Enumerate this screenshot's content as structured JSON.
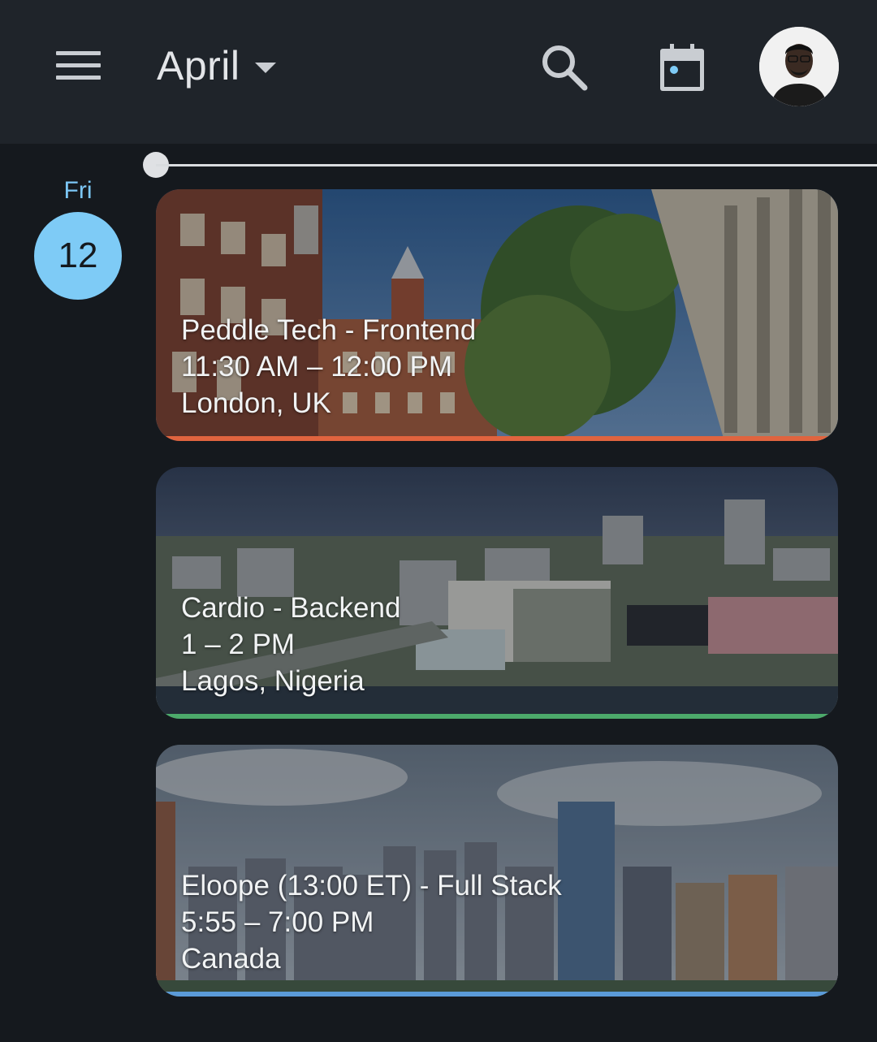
{
  "header": {
    "menu_icon": "hamburger-menu-icon",
    "month": "April",
    "search_icon": "search-icon",
    "today_icon": "calendar-today-icon",
    "avatar": "user-avatar"
  },
  "day": {
    "weekday": "Fri",
    "date": "12",
    "accent_color": "#7ecbf6"
  },
  "events": [
    {
      "title": "Peddle Tech - Frontend",
      "time": "11:30 AM – 12:00 PM",
      "location": "London, UK",
      "color": "#e0643f"
    },
    {
      "title": "Cardio - Backend",
      "time": "1 – 2 PM",
      "location": "Lagos, Nigeria",
      "color": "#4caa6b"
    },
    {
      "title": "Eloope (13:00 ET) - Full Stack",
      "time": "5:55 – 7:00 PM",
      "location": "Canada",
      "color": "#5b9bd8"
    }
  ]
}
